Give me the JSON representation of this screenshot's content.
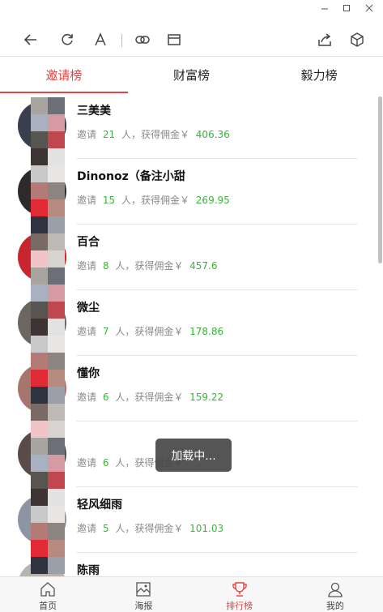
{
  "window": {
    "minimize_icon": "minimize-icon",
    "maximize_icon": "maximize-icon",
    "close_icon": "close-icon"
  },
  "toolbar": {
    "back_icon": "back-arrow-icon",
    "refresh_icon": "refresh-icon",
    "font_icon": "font-size-icon",
    "link_icon": "link-icon",
    "window_icon": "window-icon",
    "share_icon": "share-icon",
    "cube_icon": "cube-icon"
  },
  "tabs": [
    {
      "label": "邀请榜",
      "active": true
    },
    {
      "label": "财富榜",
      "active": false
    },
    {
      "label": "毅力榜",
      "active": false
    }
  ],
  "list": {
    "invite_prefix": "邀请",
    "invite_unit": "人，获得佣金￥",
    "items": [
      {
        "name": "三美美",
        "count": "21",
        "amount": "406.36"
      },
      {
        "name": "Dinonoz（备注小甜",
        "count": "15",
        "amount": "269.95"
      },
      {
        "name": "百合",
        "count": "8",
        "amount": "457.6"
      },
      {
        "name": "微尘",
        "count": "7",
        "amount": "178.86"
      },
      {
        "name": "懂你",
        "count": "6",
        "amount": "159.22"
      },
      {
        "name": "",
        "count": "6",
        "amount": ""
      },
      {
        "name": "轻风细雨",
        "count": "5",
        "amount": "101.03"
      },
      {
        "name": "陈雨",
        "count": "",
        "amount": ""
      }
    ]
  },
  "toast": {
    "text": "加载中..."
  },
  "bottom_nav": [
    {
      "label": "首页",
      "icon": "home-icon",
      "active": false
    },
    {
      "label": "海报",
      "icon": "poster-icon",
      "active": false
    },
    {
      "label": "排行榜",
      "icon": "trophy-icon",
      "active": true
    },
    {
      "label": "我的",
      "icon": "user-icon",
      "active": false
    }
  ],
  "colors": {
    "accent": "#e64340",
    "money": "#3ab53a",
    "muted": "#8a8a8a"
  }
}
